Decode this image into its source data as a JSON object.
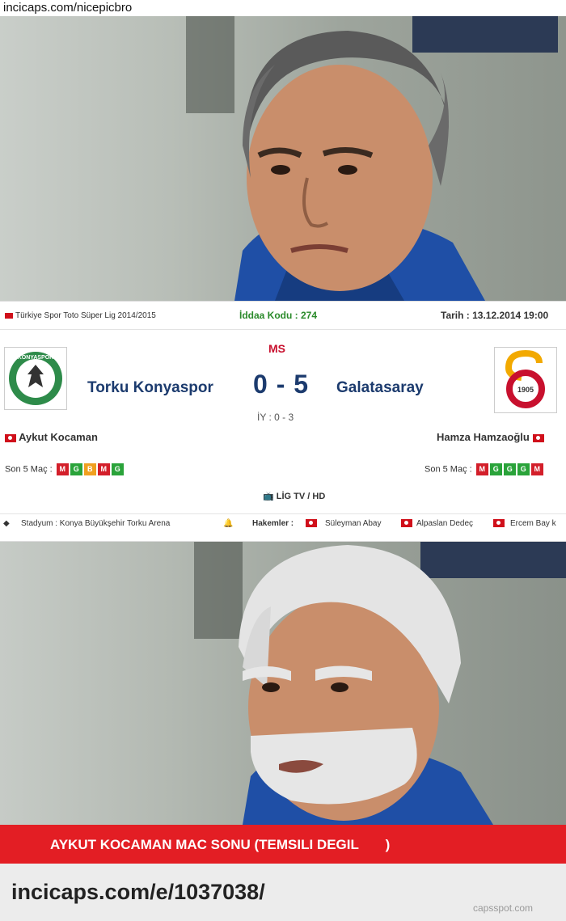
{
  "watermark_top": "incicaps.com/nicepicbro",
  "match": {
    "league": "Türkiye Spor Toto Süper Lig 2014/2015",
    "iddaa": "İddaa Kodu : 274",
    "date": "Tarih : 13.12.2014 19:00",
    "status": "MS",
    "home_team": "Torku Konyaspor",
    "away_team": "Galatasaray",
    "score": "0 - 5",
    "halftime": "İY : 0 - 3",
    "home_coach": "Aykut Kocaman",
    "away_coach": "Hamza Hamzaoğlu",
    "home_form_label": "Son 5 Maç :",
    "away_form_label": "Son 5 Maç :",
    "home_form": [
      "M",
      "G",
      "B",
      "M",
      "G"
    ],
    "away_form": [
      "M",
      "G",
      "G",
      "G",
      "M"
    ],
    "tv": "LİG TV / HD",
    "stadium": "Stadyum : Konya Büyükşehir Torku Arena",
    "referees_label": "Hakemler :",
    "referee_1": "Süleyman Abay",
    "referee_2": "Alpaslan Dedeç",
    "referee_3": "Ercem Bay k",
    "home_logo_text": "KONYASPOR",
    "away_logo_text": "1905"
  },
  "caption": "AYKUT KOCAMAN MAC SONU (TEMSILI DEGIL       )",
  "footer_url": "incicaps.com/e/1037038/",
  "footer_credit": "capsspot.com",
  "colors": {
    "banner": "#e31e24",
    "team_text": "#1c3b6e",
    "status": "#c8102e"
  }
}
